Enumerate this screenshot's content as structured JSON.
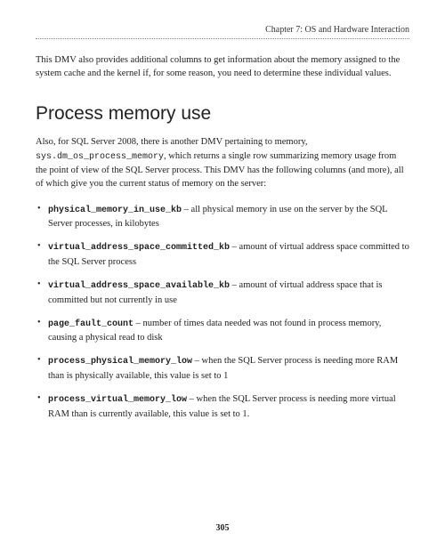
{
  "header": {
    "chapter": "Chapter 7: OS and Hardware Interaction"
  },
  "intro": "This DMV also provides additional columns to get information about the memory assigned to the system cache and the kernel if, for some reason, you need to determine these individual values.",
  "section": {
    "heading": "Process memory use",
    "para_pre": "Also, for SQL Server 2008, there is another DMV pertaining to memory, ",
    "para_code": "sys.dm_os_process_memory",
    "para_post": ", which returns a single row summarizing memory usage from the point of view of the SQL Server process. This DMV has the following columns (and more), all of which give you the current status of memory on the server:"
  },
  "bullets": [
    {
      "term": "physical_memory_in_use_kb",
      "desc": " – all physical memory in use on the server by the SQL Server processes, in kilobytes"
    },
    {
      "term": "virtual_address_space_committed_kb",
      "desc": " – amount of virtual address space committed to the SQL Server process"
    },
    {
      "term": "virtual_address_space_available_kb",
      "desc": " – amount of virtual address space that is committed but not currently in use"
    },
    {
      "term": "page_fault_count",
      "desc": " – number of times data needed was not found in process memory, causing a physical read to disk"
    },
    {
      "term": "process_physical_memory_low",
      "desc": " – when the SQL Server process is needing more RAM than is physically available, this value is set to 1"
    },
    {
      "term": "process_virtual_memory_low",
      "desc": " – when the SQL Server process is needing more virtual RAM than is currently available, this value is set to 1."
    }
  ],
  "page_number": "305"
}
